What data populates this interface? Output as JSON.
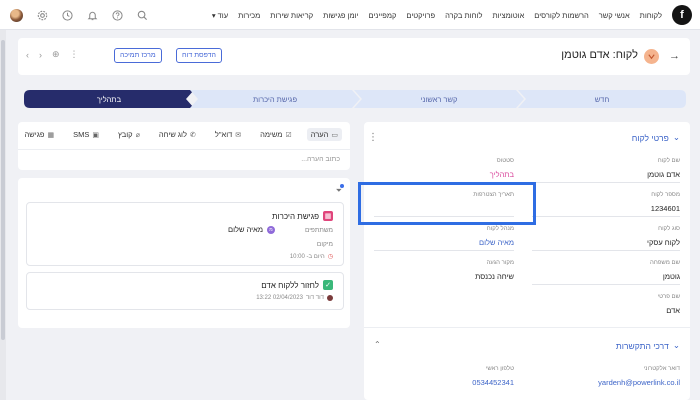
{
  "nav": {
    "logo": "f",
    "items": [
      "לקוחות",
      "אנשי קשר",
      "הרשמות לקורסים",
      "אוטומציות",
      "לוחות בקרה",
      "פרויקטים",
      "קמפיינים",
      "יומן פגישות",
      "קריאות שירות",
      "מכירות"
    ],
    "more": "עוד"
  },
  "header": {
    "title": "לקוח: אדם גוטמן",
    "print_button": "הדפסת דוח",
    "support_button": "מרכז תמיכה"
  },
  "pipeline": {
    "stages": [
      {
        "label": "חדש",
        "active": false
      },
      {
        "label": "קשר ראשוני",
        "active": false
      },
      {
        "label": "פגישת היכרות",
        "active": false
      },
      {
        "label": "בתהליך",
        "active": true
      }
    ]
  },
  "activity": {
    "tabs": [
      {
        "label": "הערה",
        "icon": "note-icon",
        "active": true
      },
      {
        "label": "משימה",
        "icon": "task-icon",
        "active": false
      },
      {
        "label": "דוא\"ל",
        "icon": "mail-icon",
        "active": false
      },
      {
        "label": "לוג שיחה",
        "icon": "phone-icon",
        "active": false
      },
      {
        "label": "קובץ",
        "icon": "paperclip-icon",
        "active": false
      },
      {
        "label": "SMS",
        "icon": "sms-icon",
        "active": false
      },
      {
        "label": "פגישה",
        "icon": "calendar-icon",
        "active": false
      }
    ],
    "note_placeholder": "כתוב הערה..."
  },
  "feed": {
    "meeting": {
      "title": "פגישת היכרות",
      "participants_label": "משתתפים",
      "participant_initial": "מ",
      "participant_name": "מאיה שלום",
      "location_label": "מיקום",
      "time": "היום ב- 10:00"
    },
    "task": {
      "title": "לחזור ללקוח אדם",
      "author": "דוד דוד",
      "date": "02/04/2023 13:22"
    }
  },
  "details": {
    "section_title": "פרטי לקוח",
    "fields": {
      "customer_name_label": "שם לקוח",
      "customer_name": "אדם גוטמן",
      "status_label": "סטטוס",
      "status": "בתהליך",
      "customer_number_label": "מספר לקוח",
      "customer_number": "1234601",
      "join_date_label": "תאריך הצטרפות",
      "customer_type_label": "סוג לקוח",
      "customer_type": "לקוח עסקי",
      "owner_label": "מנהל לקוח",
      "owner": "מאיה שלום",
      "last_name_label": "שם משפחה",
      "last_name": "גוטמן",
      "source_label": "מקור הגעה",
      "source": "שיחה נכנסת",
      "first_name_label": "שם פרטי",
      "first_name": "אדם"
    },
    "contact_section_title": "דרכי התקשרות",
    "contact": {
      "email_label": "דואר אלקטרוני",
      "email": "yardenh@powerlink.co.il",
      "phone_label": "טלפון ראשי",
      "phone": "0534452341"
    }
  }
}
